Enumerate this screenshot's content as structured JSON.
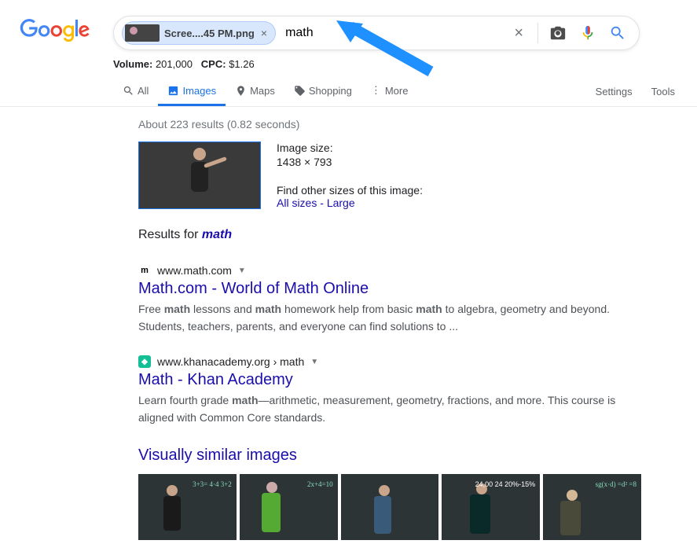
{
  "header": {
    "image_chip": {
      "label": "Scree....45 PM.png"
    },
    "search_value": "math",
    "meta": {
      "volume_label": "Volume:",
      "volume_value": "201,000",
      "cpc_label": "CPC:",
      "cpc_value": "$1.26"
    },
    "tabs": {
      "all": "All",
      "images": "Images",
      "maps": "Maps",
      "shopping": "Shopping",
      "more": "More"
    },
    "settings": "Settings",
    "tools": "Tools"
  },
  "stats": "About 223 results (0.82 seconds)",
  "preview": {
    "size_label": "Image size:",
    "size_value": "1438 × 793",
    "find_label": "Find other sizes of this image:",
    "all_sizes": "All sizes",
    "dash": " - ",
    "large": "Large"
  },
  "results_for": {
    "prefix": "Results for ",
    "term": "math"
  },
  "results": [
    {
      "favicon": "m",
      "cite": "www.math.com",
      "title": "Math.com - World of Math Online",
      "snippet_pre": "Free ",
      "b1": "math",
      "mid1": " lessons and ",
      "b2": "math",
      "mid2": " homework help from basic ",
      "b3": "math",
      "post": " to algebra, geometry and beyond. Students, teachers, parents, and everyone can find solutions to ..."
    },
    {
      "favicon": "◆",
      "cite": "www.khanacademy.org › math",
      "title": "Math - Khan Academy",
      "snippet_pre": "Learn fourth grade ",
      "b1": "math",
      "post": "—arithmetic, measurement, geometry, fractions, and more. This course is aligned with Common Core standards."
    }
  ],
  "similar": {
    "heading": "Visually similar images",
    "thumbs": [
      {
        "txt": "3+3=\n4·4\n3+2"
      },
      {
        "txt": "2x+4=10"
      },
      {
        "txt": ""
      },
      {
        "txt": "24,00\n24\n20%-15%"
      },
      {
        "txt": "sg(x·d)\n=d²\n=8"
      }
    ]
  }
}
